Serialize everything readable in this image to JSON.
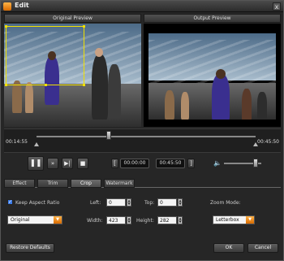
{
  "window": {
    "title": "Edit",
    "close": "x"
  },
  "panels": {
    "original_label": "Original Preview",
    "output_label": "Output Preview"
  },
  "timeline": {
    "start": "00:14:55",
    "end": "00:45:50",
    "position_fraction": 0.33
  },
  "transport": {
    "play_pause_icon": "pause-icon",
    "start_time": "00:00:00",
    "end_time": "00:45:50"
  },
  "tabs": [
    {
      "label": "Effect",
      "active": false
    },
    {
      "label": "Trim",
      "active": false
    },
    {
      "label": "Crop",
      "active": true
    },
    {
      "label": "Watermark",
      "active": false
    }
  ],
  "crop": {
    "keep_aspect_label": "Keep Aspect Ratio",
    "keep_aspect_checked": true,
    "left_label": "Left:",
    "left_value": "0",
    "top_label": "Top:",
    "top_value": "0",
    "width_label": "Width:",
    "width_value": "423",
    "height_label": "Height:",
    "height_value": "282",
    "aspect_select": "Original",
    "zoom_mode_label": "Zoom Mode:",
    "zoom_mode_value": "Letterbox"
  },
  "footer": {
    "restore": "Restore Defaults",
    "ok": "OK",
    "cancel": "Cancel"
  },
  "volume_fraction": 0.85,
  "colors": {
    "accent": "#f0e000",
    "dropdown_arrow": "#e07a10",
    "checkbox": "#3b7be8"
  }
}
